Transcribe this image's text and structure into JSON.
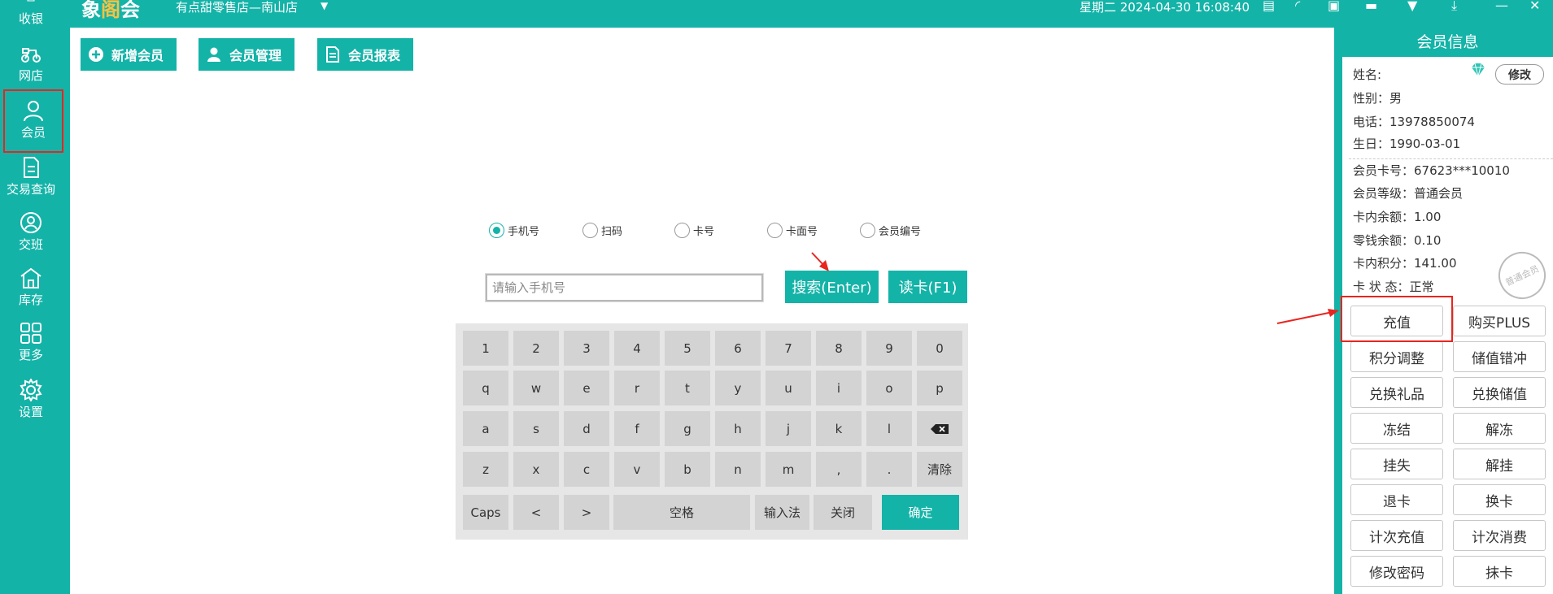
{
  "app": {
    "logo_part1": "象",
    "logo_accent": "阁",
    "logo_part2": "会",
    "store_name": "有点甜零售店—南山店",
    "datetime": "星期二 2024-04-30 16:08:40"
  },
  "sidebar": {
    "items": [
      {
        "label": "收银",
        "icon": "cashier-icon"
      },
      {
        "label": "网店",
        "icon": "scooter-icon"
      },
      {
        "label": "会员",
        "icon": "user-icon"
      },
      {
        "label": "交易查询",
        "icon": "document-icon"
      },
      {
        "label": "交班",
        "icon": "handover-icon"
      },
      {
        "label": "库存",
        "icon": "warehouse-icon"
      },
      {
        "label": "更多",
        "icon": "grid-icon"
      },
      {
        "label": "设置",
        "icon": "gear-icon"
      }
    ]
  },
  "toolbar": {
    "add_member": "新增会员",
    "manage_member": "会员管理",
    "member_report": "会员报表"
  },
  "search": {
    "modes": [
      "手机号",
      "扫码",
      "卡号",
      "卡面号",
      "会员编号"
    ],
    "selected_mode": "手机号",
    "placeholder": "请输入手机号",
    "value": "",
    "search_button": "搜索(Enter)",
    "read_card_button": "读卡(F1)"
  },
  "keyboard": {
    "row1": [
      "1",
      "2",
      "3",
      "4",
      "5",
      "6",
      "7",
      "8",
      "9",
      "0"
    ],
    "row2": [
      "q",
      "w",
      "e",
      "r",
      "t",
      "y",
      "u",
      "i",
      "o",
      "p"
    ],
    "row3": [
      "a",
      "s",
      "d",
      "f",
      "g",
      "h",
      "j",
      "k",
      "l"
    ],
    "row4": [
      "z",
      "x",
      "c",
      "v",
      "b",
      "n",
      "m",
      ",",
      ".",
      "清除"
    ],
    "row5": {
      "caps": "Caps",
      "left": "<",
      "right": ">",
      "space": "空格",
      "ime": "输入法",
      "close": "关闭",
      "confirm": "确定"
    }
  },
  "member_panel": {
    "title": "会员信息",
    "name_label": "姓名:",
    "name_value": "",
    "edit_button": "修改",
    "gender": "性别：男",
    "phone": "电话：13978850074",
    "birthday": "生日：1990-03-01",
    "card_no": "会员卡号：67623***10010",
    "level": "会员等级：普通会员",
    "balance": "卡内余额：1.00",
    "change_balance": "零钱余额：0.10",
    "points": "卡内积分：141.00",
    "status": "卡 状 态：正常",
    "stamp_text": "普通会员",
    "buttons": [
      "充值",
      "购买PLUS",
      "积分调整",
      "储值错冲",
      "兑换礼品",
      "兑换储值",
      "冻结",
      "解冻",
      "挂失",
      "解挂",
      "退卡",
      "换卡",
      "计次充值",
      "计次消费",
      "修改密码",
      "抹卡"
    ]
  },
  "colors": {
    "accent": "#14b3a8",
    "annotation_red": "#e8251f"
  }
}
